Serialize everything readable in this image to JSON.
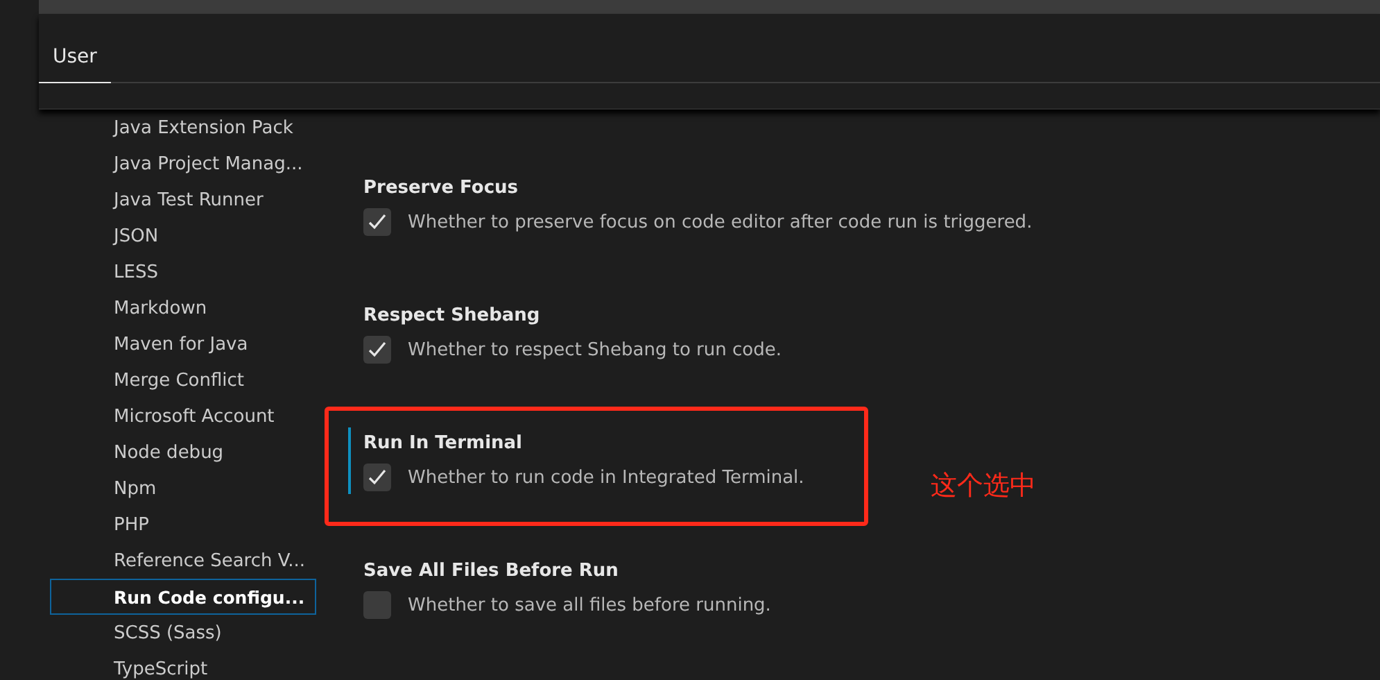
{
  "tabs": [
    {
      "label": "User",
      "selected": true
    }
  ],
  "sidebar": {
    "items": [
      {
        "label": "Java Extension Pack",
        "selected": false
      },
      {
        "label": "Java Project Manag...",
        "selected": false
      },
      {
        "label": "Java Test Runner",
        "selected": false
      },
      {
        "label": "JSON",
        "selected": false
      },
      {
        "label": "LESS",
        "selected": false
      },
      {
        "label": "Markdown",
        "selected": false
      },
      {
        "label": "Maven for Java",
        "selected": false
      },
      {
        "label": "Merge Conflict",
        "selected": false
      },
      {
        "label": "Microsoft Account",
        "selected": false
      },
      {
        "label": "Node debug",
        "selected": false
      },
      {
        "label": "Npm",
        "selected": false
      },
      {
        "label": "PHP",
        "selected": false
      },
      {
        "label": "Reference Search V...",
        "selected": false
      },
      {
        "label": "Run Code configu...",
        "selected": true
      },
      {
        "label": "SCSS (Sass)",
        "selected": false
      },
      {
        "label": "TypeScript",
        "selected": false
      }
    ]
  },
  "settings": [
    {
      "title": "Preserve Focus",
      "description": "Whether to preserve focus on code editor after code run is triggered.",
      "checked": true,
      "focused": false
    },
    {
      "title": "Respect Shebang",
      "description": "Whether to respect Shebang to run code.",
      "checked": true,
      "focused": false
    },
    {
      "title": "Run In Terminal",
      "description": "Whether to run code in Integrated Terminal.",
      "checked": true,
      "focused": true
    },
    {
      "title": "Save All Files Before Run",
      "description": "Whether to save all files before running.",
      "checked": false,
      "focused": false
    }
  ],
  "annotation": {
    "text": "这个选中"
  }
}
